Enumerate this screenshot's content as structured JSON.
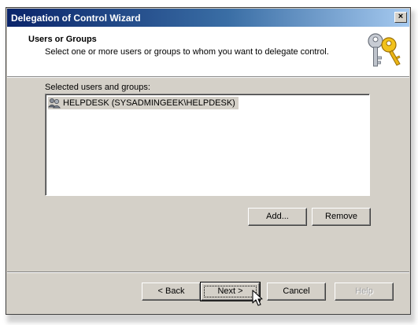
{
  "window": {
    "title": "Delegation of Control Wizard",
    "close_glyph": "×"
  },
  "header": {
    "title": "Users or Groups",
    "subtitle": "Select one or more users or groups to whom you want to delegate control.",
    "icon": "keys-icon"
  },
  "list": {
    "label": "Selected users and groups:",
    "items": [
      {
        "label": "HELPDESK (SYSADMINGEEK\\HELPDESK)",
        "icon": "group-icon",
        "selected": true
      }
    ]
  },
  "actions": {
    "add_label": "Add...",
    "remove_label": "Remove"
  },
  "footer": {
    "back_label": "< Back",
    "next_label": "Next >",
    "cancel_label": "Cancel",
    "help_label": "Help",
    "help_disabled": true
  }
}
